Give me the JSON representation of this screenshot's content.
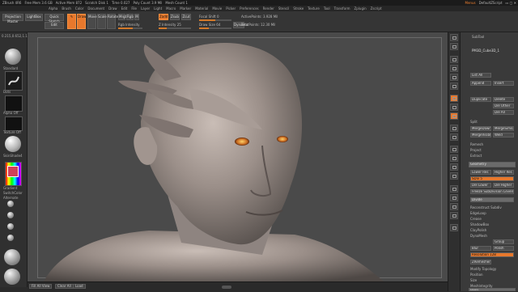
{
  "title_bar": {
    "app": "ZBrush 4R6",
    "segments": [
      "Free Mem 3.6 GB",
      "Active Mem 872",
      "Scratch Disk 1",
      "Time 0.027",
      "Poly Count 3.9 Mil",
      "Mesh Count 1"
    ],
    "right": [
      "Menus",
      "DefaultZScript"
    ]
  },
  "menus": [
    "Alpha",
    "Brush",
    "Color",
    "Document",
    "Draw",
    "Edit",
    "File",
    "Layer",
    "Light",
    "Macro",
    "Marker",
    "Material",
    "Movie",
    "Picker",
    "Preferences",
    "Render",
    "Stencil",
    "Stroke",
    "Texture",
    "Tool",
    "Transform",
    "Zplugin",
    "Zscript"
  ],
  "toolbar": {
    "projection_master": "Projection Master",
    "lightbox": "LightBox",
    "quick_sketch": "Quick Sketch",
    "edit": "Edit",
    "draw": "Draw",
    "move": "Move",
    "scale": "Scale",
    "rotate": "Rotate",
    "mrgb": "Mrgb",
    "rgb": "Rgb",
    "m": "M",
    "zadd": "Zadd",
    "zsub": "Zsub",
    "zcut": "Zcut",
    "rgb_intensity": "Rgb Intensity",
    "z_intensity": "Z Intensity 25",
    "focal_shift": "Focal Shift 0",
    "draw_size": "Draw Size 64",
    "dynamic": "Dynamic",
    "active_points": "ActivePoints: 3.928 Mil",
    "total_points": "TotalPoints: 12.30 Mil"
  },
  "left_shelf": {
    "items": [
      "Standard",
      "Dots",
      "Alpha Off",
      "Texture Off",
      "SkinShade4",
      "Gradient",
      "SwitchColor",
      "Alternate"
    ],
    "coords": "0.215,0.652,1.13"
  },
  "right_shelf": {
    "buttons": [
      "BPR",
      "SPix 3",
      "Scroll",
      "Zoom",
      "Actual",
      "AAHalf",
      "Persp",
      "Floor",
      "Local",
      "L.Sym",
      "Xpose",
      "Frame",
      "Move",
      "Scale",
      "Rotate",
      "PolyF",
      "Transp",
      "Ghost",
      "Solo",
      "Dynamic"
    ]
  },
  "right_panel": {
    "header": "SubTool",
    "tool_name": "PM3D_Cube3D_1",
    "list_all": "List All",
    "append": "Append",
    "insert": "Insert",
    "duplicate": "Duplicate",
    "delete": "Delete",
    "del_other": "Del Other",
    "del_all": "Del All",
    "split": "Split",
    "merge_down": "MergeDown",
    "merge_similar": "MergeSimilar",
    "merge_visible": "MergeVisible",
    "weld": "Weld",
    "uv": "Uv",
    "remesh": "Remesh",
    "project": "Project",
    "extract": "Extract",
    "geometry": "Geometry",
    "lower_res": "Lower Res",
    "higher_res": "Higher Res",
    "sdiv": "SDiv 5",
    "del_lower": "Del Lower",
    "del_higher": "Del Higher",
    "freeze": "Freeze SubDivision Levels",
    "reconstruct": "Reconstruct Subdiv",
    "divide": "Divide",
    "smt": "Smt",
    "suv": "Suv",
    "rsuv": "ReUV",
    "edge_loop": "EdgeLoop",
    "crease": "Crease",
    "shadow_box": "ShadowBox",
    "clay_polish": "ClayPolish",
    "dynamesh": "DynaMesh",
    "group": "Group",
    "polish": "Polish",
    "blur": "Blur",
    "project_btn": "Project",
    "resolution": "Resolution 128",
    "zremesher": "ZRemesher",
    "modify_topology": "Modify Topology",
    "position": "Position",
    "size": "Size",
    "mesh_integrity": "MeshIntegrity",
    "layers": "Layers"
  },
  "bottom_bar": {
    "btn1": "Fill All View",
    "btn2": "Clear All",
    "btn3": "Load"
  }
}
